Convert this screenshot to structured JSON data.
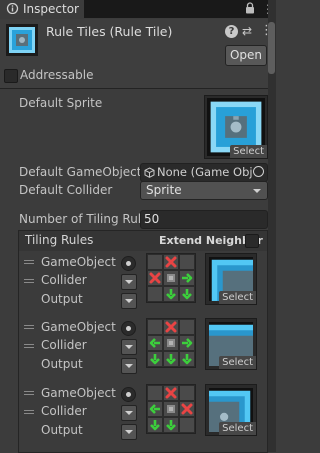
{
  "tab": {
    "title": "Inspector",
    "icon": "info-icon",
    "lock_icon": "lock-icon",
    "menu_icon": "menu-icon"
  },
  "header": {
    "title": "Rule Tiles (Rule Tile)",
    "asset_icon": "rule-tile-asset-icon",
    "help_icon": "help-icon",
    "help_glyph": "?",
    "preset_icon": "preset-icon",
    "preset_glyph": "⇄",
    "kebab_icon": "kebab-menu-icon",
    "kebab_glyph": "⋮",
    "open_label": "Open",
    "addressable_label": "Addressable",
    "addressable_checked": false
  },
  "fields": {
    "default_sprite_label": "Default Sprite",
    "default_sprite_select": "Select",
    "default_gameobject_label": "Default GameObject",
    "default_gameobject_value": "None (Game Obj",
    "default_collider_label": "Default Collider",
    "default_collider_value": "Sprite",
    "tiling_count_label": "Number of Tiling Rule",
    "tiling_count_value": "50"
  },
  "tiling_rules": {
    "header": "Tiling Rules",
    "extend_neighbor_label": "Extend Neighbor",
    "extend_neighbor_checked": false,
    "rules": [
      {
        "gameobject_label": "GameObject",
        "collider_label": "Collider",
        "output_label": "Output",
        "select_label": "Select",
        "sprite": "corner-top-left",
        "cells": [
          "empty",
          "x",
          "empty",
          "x",
          "center",
          "right",
          "empty",
          "down",
          "down"
        ]
      },
      {
        "gameobject_label": "GameObject",
        "collider_label": "Collider",
        "output_label": "Output",
        "select_label": "Select",
        "sprite": "edge-top",
        "cells": [
          "empty",
          "x",
          "empty",
          "left",
          "center",
          "right",
          "down",
          "down",
          "down"
        ]
      },
      {
        "gameobject_label": "GameObject",
        "collider_label": "Collider",
        "output_label": "Output",
        "select_label": "Select",
        "sprite": "corner-top-right",
        "cells": [
          "empty",
          "x",
          "empty",
          "left",
          "center",
          "x",
          "down",
          "down",
          "empty"
        ]
      }
    ]
  },
  "colors": {
    "x": "#e84444",
    "arrow": "#3ccf3c",
    "tile_blue": "#52c7f4"
  }
}
